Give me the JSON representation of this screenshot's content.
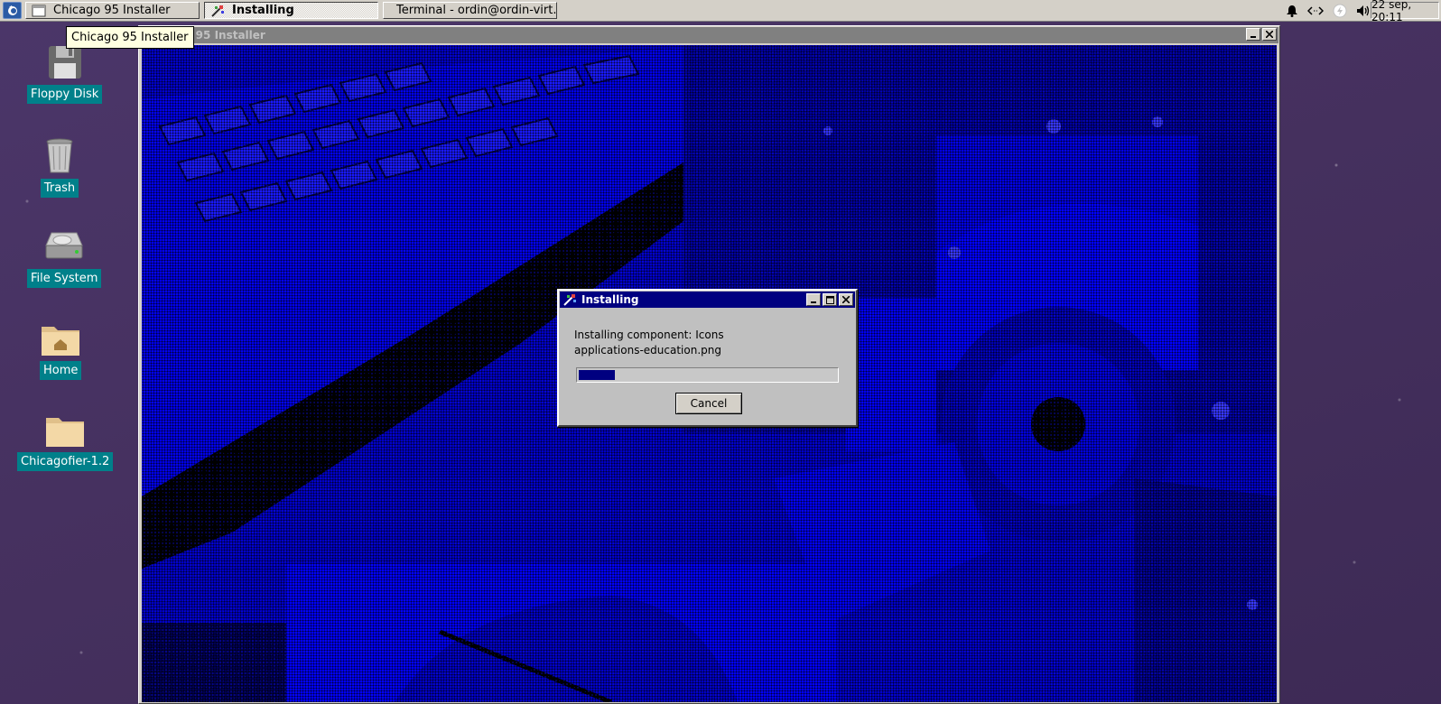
{
  "taskbar": {
    "menu_icon": "start-menu-icon",
    "tasks": [
      {
        "label": "Chicago 95 Installer",
        "icon": "window-icon",
        "active": false
      },
      {
        "label": "Installing",
        "icon": "installer-icon",
        "active": true
      },
      {
        "label": "Terminal - ordin@ordin-virt...",
        "icon": "terminal-icon",
        "active": false
      }
    ],
    "tray_icons": [
      "notification-bell-icon",
      "network-icon",
      "power-icon",
      "volume-icon"
    ],
    "clock": "22 sep, 20:11"
  },
  "tooltip": "Chicago 95 Installer",
  "desktop_icons": [
    {
      "label": "Floppy Disk",
      "icon": "floppy-disk-icon"
    },
    {
      "label": "Trash",
      "icon": "trash-icon"
    },
    {
      "label": "File System",
      "icon": "hard-drive-icon"
    },
    {
      "label": "Home",
      "icon": "home-folder-icon"
    },
    {
      "label": "Chicagofier-1.2",
      "icon": "folder-icon"
    }
  ],
  "installer_window": {
    "title": "Chicago 95 Installer"
  },
  "dialog": {
    "title": "Installing",
    "line1": "Installing component: Icons",
    "line2": "applications-education.png",
    "progress": 0.14,
    "cancel_label": "Cancel"
  },
  "colors": {
    "titlebar_active": "#000080",
    "titlebar_inactive": "#808080",
    "desktop_label_bg": "#00808a",
    "wallpaper_blue": "#0000c8"
  }
}
